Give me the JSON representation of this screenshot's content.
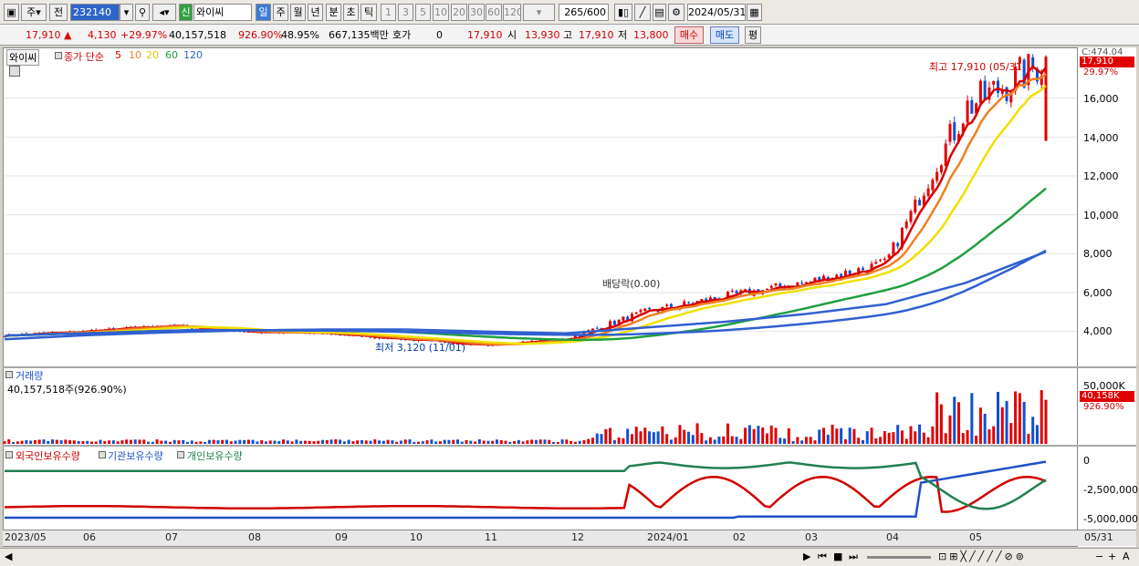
{
  "toolbar": {
    "market": "주",
    "prev": "전",
    "code": "232140",
    "badge": "신",
    "name": "와이씨",
    "periods": [
      "일",
      "주",
      "월",
      "년",
      "분",
      "초",
      "틱"
    ],
    "ticks": [
      "1",
      "3",
      "5",
      "10",
      "20",
      "30",
      "60",
      "120"
    ],
    "count": "265",
    "total": "/600",
    "date": "2024/05/31"
  },
  "quote": {
    "price": "17,910",
    "change": "4,130",
    "rate": "+29.97%",
    "volume": "40,157,518",
    "vol_rate": "926.90%",
    "turnover": "48.95%",
    "amount": "667,135백만",
    "hoga_label": "호가",
    "hoga": "0",
    "ask": "17,910",
    "open_label": "시",
    "open": "13,930",
    "high_label": "고",
    "high": "17,910",
    "low_label": "저",
    "low": "13,800",
    "buy": "매수",
    "sell": "매도",
    "eval": "평"
  },
  "price_panel": {
    "name": "와이씨",
    "legend_prefix": "종가 단순",
    "ma_labels": [
      "5",
      "10",
      "20",
      "60",
      "120"
    ],
    "ma_colors": [
      "#d80000",
      "#f08020",
      "#f0e000",
      "#20a040",
      "#3060d0"
    ],
    "high_note": "최고 17,910 (05/31)",
    "low_note": "최저 3,120 (11/01)",
    "dividend_note": "배당락(0.00)",
    "top_clip": "C:474.04",
    "current_tag": "17,910",
    "current_rate": "29.97%",
    "y_ticks": [
      "16,000",
      "14,000",
      "12,000",
      "10,000",
      "8,000",
      "6,000",
      "4,000"
    ]
  },
  "volume_panel": {
    "title": "거래량",
    "value": "40,157,518주(926.90%)",
    "y_tick": "50,000K",
    "tag": "40,158K",
    "tag2": "926.90%"
  },
  "holding_panel": {
    "titles": [
      "외국인보유수량",
      "기관보유수량",
      "개인보유수량"
    ],
    "colors": [
      "#d00000",
      "#2050c8",
      "#208050"
    ],
    "y_ticks": [
      "0",
      "-2,500,000",
      "-5,000,000"
    ]
  },
  "x_axis": [
    "2023/05",
    "06",
    "07",
    "08",
    "09",
    "10",
    "11",
    "12",
    "2024/01",
    "02",
    "03",
    "04",
    "05",
    "05/31"
  ],
  "chart_data": {
    "type": "candlestick",
    "x": [
      "2023/05",
      "06",
      "07",
      "08",
      "09",
      "10",
      "11",
      "12",
      "2024/01",
      "02",
      "03",
      "04",
      "05",
      "05/31"
    ],
    "close_approx": [
      3800,
      4000,
      4300,
      4000,
      3900,
      3600,
      3300,
      3600,
      5000,
      5800,
      6500,
      7500,
      15500,
      17910
    ],
    "ma120_approx": [
      3600,
      3800,
      3950,
      4050,
      4100,
      4100,
      4000,
      3900,
      4200,
      4500,
      4900,
      5400,
      6500,
      8100
    ],
    "ylim": [
      3000,
      18000
    ]
  }
}
